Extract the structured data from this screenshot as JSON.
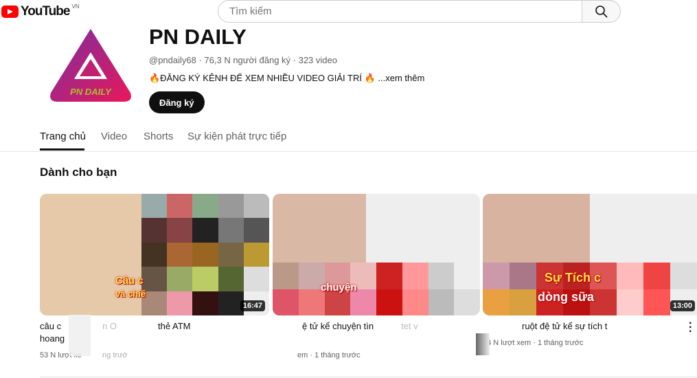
{
  "header": {
    "logo_text": "YouTube",
    "region": "VN",
    "search_placeholder": "Tìm kiếm",
    "search_icon": "magnifier-icon"
  },
  "channel": {
    "name": "PN DAILY",
    "avatar_text": "PN DAILY",
    "meta": "@pndaily68 · 76,3 N người đăng ký · 323 video",
    "description": "🔥ĐĂNG KÝ KÊNH ĐỂ XEM NHIỀU VIDEO GIẢI TRÍ 🔥",
    "more": "...xem thêm",
    "subscribe": "Đăng ký"
  },
  "tabs": [
    {
      "label": "Trang chủ",
      "active": true
    },
    {
      "label": "Video"
    },
    {
      "label": "Shorts"
    },
    {
      "label": "Sự kiện phát trực tiếp"
    }
  ],
  "section_title": "Dành cho bạn",
  "videos": [
    {
      "title_line1": "câu c",
      "title_mid": "n O",
      "title_end": "thẻ ATM",
      "title_line2": "hoang",
      "meta_start": "53 N lượt xe",
      "meta_end": "ng trướ",
      "duration": "16:47",
      "overlay1": "Câu c",
      "overlay2": "và chiế"
    },
    {
      "title": "ệ tử kể chuyện tìn",
      "title_end": "tet v",
      "meta": "em · 1 tháng trước",
      "overlay1": "chuyện"
    },
    {
      "title": "ruột đệ tử kể sự tích t",
      "meta": "34 N lượt xem · 1 tháng trước",
      "duration": "13:00",
      "overlay1": "Sự Tích c",
      "overlay2": "dòng sữa"
    }
  ]
}
